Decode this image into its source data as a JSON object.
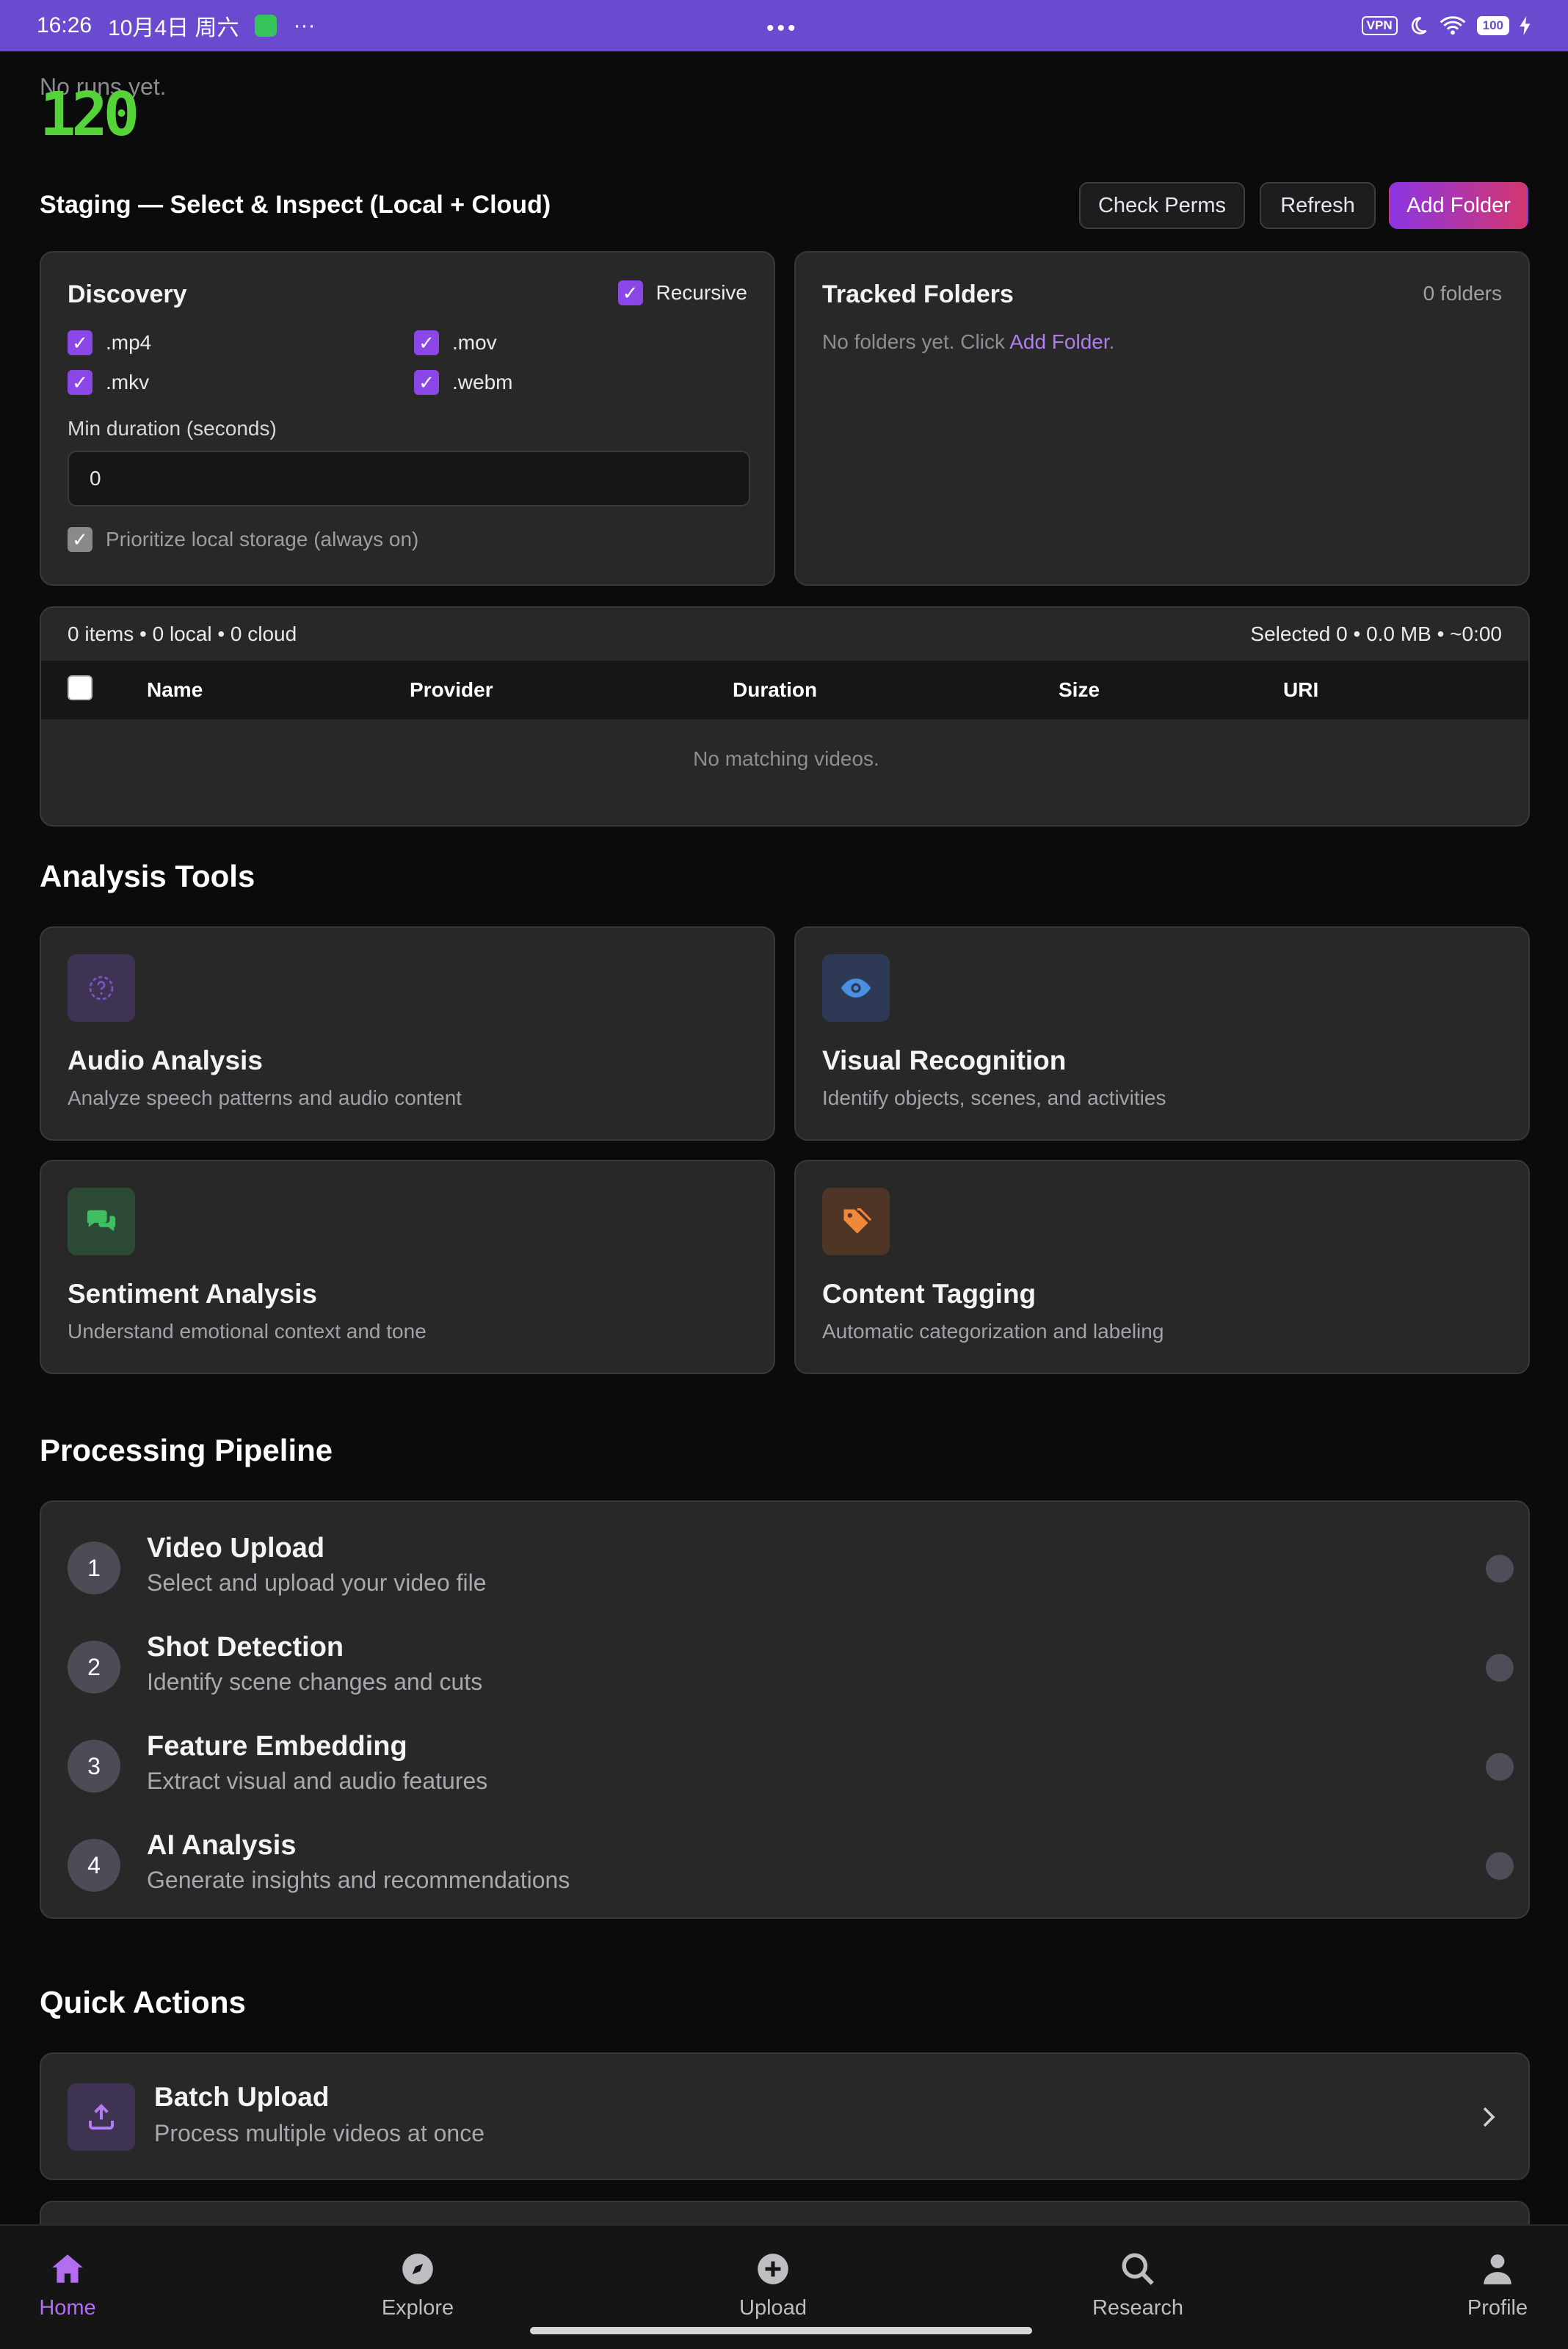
{
  "status_bar": {
    "time": "16:26",
    "date": "10月4日 周六",
    "more": "···",
    "center": "•••",
    "vpn": "VPN",
    "battery": "100"
  },
  "runs": {
    "empty_text": "No runs yet.",
    "counter": "120"
  },
  "staging": {
    "title": "Staging — Select & Inspect (Local + Cloud)",
    "check_perms": "Check Perms",
    "refresh": "Refresh",
    "add_folder": "Add Folder"
  },
  "discovery": {
    "title": "Discovery",
    "recursive": "Recursive",
    "extensions": [
      ".mp4",
      ".mov",
      ".mkv",
      ".webm"
    ],
    "min_duration_label": "Min duration (seconds)",
    "min_duration_value": "0",
    "prioritize_label": "Prioritize local storage (always on)"
  },
  "tracked": {
    "title": "Tracked Folders",
    "count": "0 folders",
    "empty_prefix": "No folders yet. Click ",
    "empty_link": "Add Folder",
    "empty_suffix": "."
  },
  "table": {
    "summary": "0 items • 0 local • 0 cloud",
    "selection": "Selected 0 • 0.0 MB • ~0:00",
    "columns": [
      "Name",
      "Provider",
      "Duration",
      "Size",
      "URI"
    ],
    "empty": "No matching videos."
  },
  "analysis": {
    "title": "Analysis Tools",
    "tools": [
      {
        "title": "Audio Analysis",
        "desc": "Analyze speech patterns and audio content",
        "icon": "question-circle-icon",
        "color": "#8b46e8"
      },
      {
        "title": "Visual Recognition",
        "desc": "Identify objects, scenes, and activities",
        "icon": "eye-icon",
        "color": "#4a90e2"
      },
      {
        "title": "Sentiment Analysis",
        "desc": "Understand emotional context and tone",
        "icon": "chat-bubbles-icon",
        "color": "#3fbf60"
      },
      {
        "title": "Content Tagging",
        "desc": "Automatic categorization and labeling",
        "icon": "tag-icon",
        "color": "#f0883a"
      }
    ]
  },
  "pipeline": {
    "title": "Processing Pipeline",
    "steps": [
      {
        "num": "1",
        "title": "Video Upload",
        "desc": "Select and upload your video file"
      },
      {
        "num": "2",
        "title": "Shot Detection",
        "desc": "Identify scene changes and cuts"
      },
      {
        "num": "3",
        "title": "Feature Embedding",
        "desc": "Extract visual and audio features"
      },
      {
        "num": "4",
        "title": "AI Analysis",
        "desc": "Generate insights and recommendations"
      }
    ]
  },
  "quick_actions": {
    "title": "Quick Actions",
    "items": [
      {
        "title": "Batch Upload",
        "desc": "Process multiple videos at once",
        "icon": "upload-icon"
      }
    ]
  },
  "nav": {
    "items": [
      {
        "label": "Home",
        "icon": "home-icon"
      },
      {
        "label": "Explore",
        "icon": "compass-icon"
      },
      {
        "label": "Upload",
        "icon": "plus-circle-icon"
      },
      {
        "label": "Research",
        "icon": "search-icon"
      },
      {
        "label": "Profile",
        "icon": "person-icon"
      }
    ],
    "active": "Home",
    "accent": "#b36ef0"
  }
}
